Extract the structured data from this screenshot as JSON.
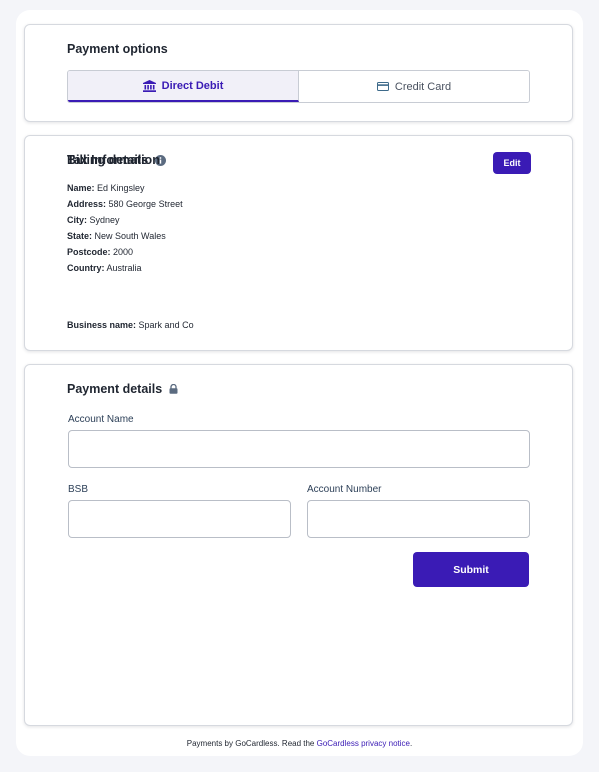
{
  "payment_options": {
    "title": "Payment options",
    "tabs": [
      {
        "label": "Direct Debit",
        "icon": "bank-icon",
        "active": true
      },
      {
        "label": "Credit Card",
        "icon": "credit-card-icon",
        "active": false
      }
    ]
  },
  "billing": {
    "title": "Billing details",
    "edit_label": "Edit",
    "fields": [
      {
        "key": "Name:",
        "value": "Ed Kingsley"
      },
      {
        "key": "Address:",
        "value": "580 George Street"
      },
      {
        "key": "City:",
        "value": "Sydney"
      },
      {
        "key": "State:",
        "value": "New South Wales"
      },
      {
        "key": "Postcode:",
        "value": "2000"
      },
      {
        "key": "Country:",
        "value": "Australia"
      }
    ],
    "tax_title": "Tax Information",
    "tax_fields": [
      {
        "key": "Business name:",
        "value": "Spark and Co"
      }
    ]
  },
  "payment_details": {
    "title": "Payment details",
    "account_name_label": "Account Name",
    "account_name_value": "",
    "bsb_label": "BSB",
    "bsb_value": "",
    "account_number_label": "Account Number",
    "account_number_value": "",
    "submit_label": "Submit"
  },
  "footer": {
    "text": "Payments by GoCardless. Read the ",
    "link": "GoCardless privacy notice",
    "suffix": "."
  },
  "colors": {
    "accent": "#3a1bb5",
    "background": "#f4f5f9"
  }
}
